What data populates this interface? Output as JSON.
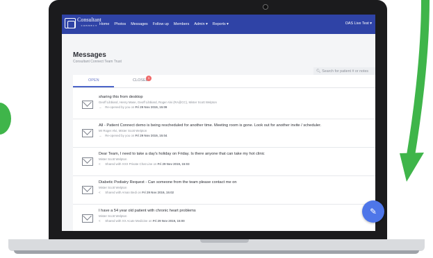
{
  "nav": {
    "brand_name": "Consultant",
    "brand_sub": "CONNECT",
    "items": [
      "Home",
      "Photos",
      "Messages",
      "Follow up",
      "Members",
      "Admin ▾",
      "Reports ▾"
    ],
    "user": "OAS Live Test ▾"
  },
  "page": {
    "title": "Messages",
    "subtitle": "Consultant Connect Team Trust"
  },
  "search": {
    "placeholder": "Search for patient # or notes"
  },
  "tabs": {
    "open": "OPEN",
    "closed": "CLOSED",
    "closed_badge": "1"
  },
  "messages": [
    {
      "title": "sharing this from desktop",
      "people": "Geoff Libbiard, Henry Mase, Geoff Libbiard, Roger Alvi (RA@CC), Mister Scott Welpton",
      "meta_icon": "reopen-icon",
      "meta_prefix": "Re-opened by you on",
      "meta_date": "Fri 29 Nov 2019, 15:09"
    },
    {
      "title": "All - Patient Connect demo is being rescheduled for another time. Meeting room is gone. Look out for another invite / scheduler.",
      "people": "Mr Roger Alvi, Mister Scott Welpton",
      "meta_icon": "reopen-icon",
      "meta_prefix": "Re-opened by you on",
      "meta_date": "Fri 29 Nov 2019, 15:04"
    },
    {
      "title": "Dear Team, I need to take a day's holiday on Friday. Is there anyone that can take my hot clinic",
      "people": "Mister Scott Welpton",
      "meta_icon": "share-icon",
      "meta_prefix": "Shared with XXX Private Chat Line on",
      "meta_date": "Fri 29 Nov 2019, 15:03"
    },
    {
      "title": "Diabetic Podiatry Request - Can someone from the team please contact me on",
      "people": "Mister Scott Welpton",
      "meta_icon": "share-icon",
      "meta_prefix": "Shared with Aman Bedi on",
      "meta_date": "Fri 29 Nov 2019, 15:02"
    },
    {
      "title": "I have a 54 year old patient with chronic heart problems",
      "people": "Mister Scott Welpton",
      "meta_icon": "share-icon",
      "meta_prefix": "Shared with XX Acute Medicine on",
      "meta_date": "Fri 29 Nov 2019, 15:00"
    }
  ],
  "fab": {
    "icon": "pencil-icon"
  },
  "colors": {
    "navbar": "#2f43a6",
    "accent": "#4e76e9",
    "badge": "#ef6b6b",
    "decor_green": "#3fb54a"
  }
}
